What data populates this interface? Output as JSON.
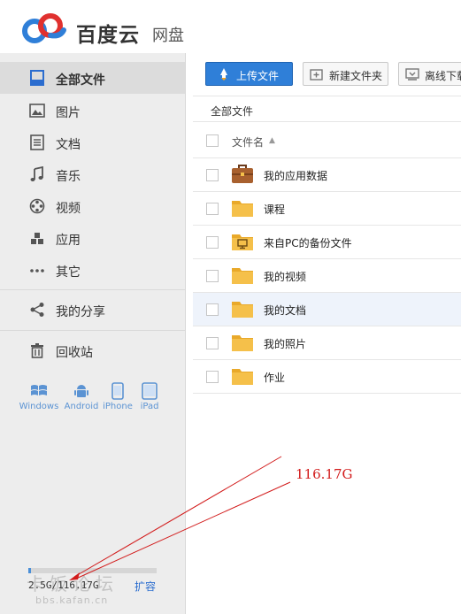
{
  "header": {
    "brand": "百度云",
    "product": "网盘"
  },
  "sidebar": {
    "items": [
      {
        "label": "全部文件",
        "icon": "all-files-icon",
        "active": true
      },
      {
        "label": "图片",
        "icon": "picture-icon"
      },
      {
        "label": "文档",
        "icon": "document-icon"
      },
      {
        "label": "音乐",
        "icon": "music-icon"
      },
      {
        "label": "视频",
        "icon": "video-icon"
      },
      {
        "label": "应用",
        "icon": "apps-icon"
      },
      {
        "label": "其它",
        "icon": "more-icon"
      }
    ],
    "share_label": "我的分享",
    "recycle_label": "回收站",
    "devices": [
      "Windows",
      "Android",
      "iPhone",
      "iPad"
    ],
    "quota_text": "2.5G/116.17G",
    "quota_fraction": 0.02,
    "expand_label": "扩容"
  },
  "toolbar": {
    "upload_label": "上传文件",
    "new_folder_label": "新建文件夹",
    "offline_label": "离线下载"
  },
  "breadcrumb": "全部文件",
  "list": {
    "column_name": "文件名",
    "files": [
      {
        "name": "我的应用数据",
        "icon": "briefcase-folder-icon"
      },
      {
        "name": "课程",
        "icon": "folder-icon"
      },
      {
        "name": "来自PC的备份文件",
        "icon": "pc-backup-folder-icon"
      },
      {
        "name": "我的视频",
        "icon": "folder-icon"
      },
      {
        "name": "我的文档",
        "icon": "folder-icon"
      },
      {
        "name": "我的照片",
        "icon": "folder-icon"
      },
      {
        "name": "作业",
        "icon": "folder-icon"
      }
    ]
  },
  "annotation": {
    "text": "116.17G",
    "color": "#d21b1b"
  },
  "watermark": {
    "text": "卡饭论坛",
    "url": "bbs.kafan.cn"
  },
  "colors": {
    "accent": "#2f7fd8",
    "sidebar_bg": "#ededed",
    "folder": "#f5c04a"
  }
}
